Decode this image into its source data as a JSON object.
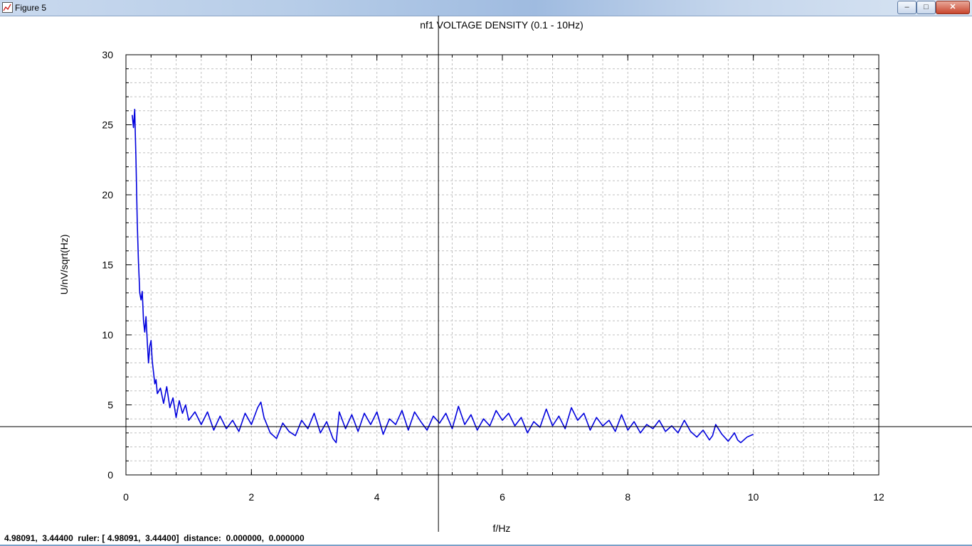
{
  "window": {
    "title": "Figure 5",
    "minimize_glyph": "–",
    "maximize_glyph": "□",
    "close_glyph": "✕",
    "app_icon": "figure-icon"
  },
  "status": {
    "text": "4.98091,  3.44400  ruler: [ 4.98091,  3.44400]  distance:  0.000000,  0.000000"
  },
  "colors": {
    "line": "#0000dd",
    "grid": "#c0c0c0",
    "crosshair": "#000000"
  },
  "crosshair": {
    "x": 4.98091,
    "y": 3.444
  },
  "chart_data": {
    "type": "line",
    "title": "nf1 VOLTAGE DENSITY (0.1 - 10Hz)",
    "xlabel": "f/Hz",
    "ylabel": "U/nV/sqrt(Hz)",
    "xlim": [
      0,
      12
    ],
    "ylim": [
      0,
      30
    ],
    "xticks": [
      0,
      2,
      4,
      6,
      8,
      10,
      12
    ],
    "yticks": [
      0,
      5,
      10,
      15,
      20,
      25,
      30
    ],
    "grid": true,
    "series": [
      {
        "x": [
          0.1,
          0.12,
          0.14,
          0.16,
          0.18,
          0.2,
          0.22,
          0.24,
          0.26,
          0.28,
          0.3,
          0.32,
          0.34,
          0.36,
          0.38,
          0.4,
          0.42,
          0.44,
          0.46,
          0.48,
          0.5,
          0.55,
          0.6,
          0.65,
          0.7,
          0.75,
          0.8,
          0.85,
          0.9,
          0.95,
          1.0,
          1.1,
          1.2,
          1.3,
          1.4,
          1.5,
          1.6,
          1.7,
          1.8,
          1.9,
          2.0,
          2.1,
          2.15,
          2.2,
          2.3,
          2.4,
          2.5,
          2.6,
          2.7,
          2.8,
          2.9,
          3.0,
          3.1,
          3.2,
          3.3,
          3.35,
          3.4,
          3.5,
          3.6,
          3.7,
          3.8,
          3.9,
          4.0,
          4.1,
          4.2,
          4.3,
          4.4,
          4.5,
          4.6,
          4.7,
          4.8,
          4.9,
          5.0,
          5.1,
          5.2,
          5.3,
          5.4,
          5.5,
          5.6,
          5.7,
          5.8,
          5.9,
          6.0,
          6.1,
          6.2,
          6.3,
          6.4,
          6.5,
          6.6,
          6.7,
          6.8,
          6.9,
          7.0,
          7.1,
          7.2,
          7.3,
          7.4,
          7.5,
          7.6,
          7.7,
          7.8,
          7.9,
          8.0,
          8.1,
          8.2,
          8.3,
          8.4,
          8.5,
          8.6,
          8.7,
          8.8,
          8.9,
          9.0,
          9.1,
          9.2,
          9.3,
          9.35,
          9.4,
          9.5,
          9.6,
          9.7,
          9.75,
          9.8,
          9.9,
          10.0
        ],
        "y": [
          25.7,
          24.8,
          26.1,
          22.5,
          18.0,
          15.2,
          13.0,
          12.5,
          13.1,
          11.0,
          10.2,
          11.3,
          9.5,
          8.0,
          9.2,
          9.6,
          8.1,
          7.3,
          6.5,
          6.8,
          5.8,
          6.2,
          5.1,
          6.3,
          4.8,
          5.5,
          4.1,
          5.3,
          4.4,
          5.0,
          3.9,
          4.5,
          3.6,
          4.5,
          3.2,
          4.2,
          3.3,
          3.9,
          3.1,
          4.4,
          3.6,
          4.8,
          5.2,
          4.1,
          3.0,
          2.6,
          3.7,
          3.1,
          2.8,
          3.9,
          3.3,
          4.4,
          3.0,
          3.8,
          2.6,
          2.3,
          4.5,
          3.3,
          4.3,
          3.1,
          4.4,
          3.6,
          4.5,
          2.9,
          4.0,
          3.6,
          4.6,
          3.2,
          4.5,
          3.8,
          3.2,
          4.2,
          3.7,
          4.4,
          3.3,
          4.9,
          3.6,
          4.3,
          3.2,
          4.0,
          3.5,
          4.6,
          3.9,
          4.4,
          3.5,
          4.1,
          3.0,
          3.8,
          3.4,
          4.7,
          3.5,
          4.2,
          3.3,
          4.8,
          3.9,
          4.4,
          3.2,
          4.1,
          3.5,
          3.9,
          3.1,
          4.3,
          3.2,
          3.8,
          3.0,
          3.6,
          3.3,
          3.9,
          3.1,
          3.5,
          3.0,
          3.9,
          3.1,
          2.7,
          3.2,
          2.5,
          2.8,
          3.6,
          2.9,
          2.4,
          3.0,
          2.5,
          2.3,
          2.7,
          2.9
        ]
      }
    ]
  }
}
